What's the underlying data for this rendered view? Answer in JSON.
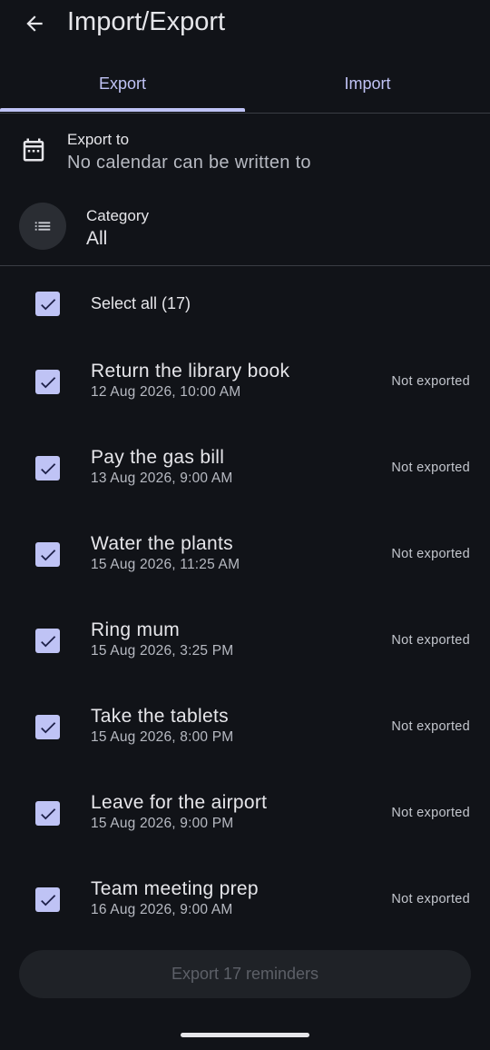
{
  "appbar": {
    "title": "Import/Export",
    "back_icon": "arrow-left-icon"
  },
  "tabs": [
    {
      "label": "Export",
      "selected": true
    },
    {
      "label": "Import",
      "selected": false
    }
  ],
  "export_to": {
    "label": "Export to",
    "value": "No calendar can be written to",
    "icon": "calendar-icon"
  },
  "category": {
    "label": "Category",
    "value": "All",
    "icon": "list-icon"
  },
  "select_all": {
    "label": "Select all (17)",
    "checked": true
  },
  "reminders": [
    {
      "title": "Return the library book",
      "date": "12 Aug 2026, 10:00 AM",
      "status": "Not exported",
      "checked": true
    },
    {
      "title": "Pay the gas bill",
      "date": "13 Aug 2026, 9:00 AM",
      "status": "Not exported",
      "checked": true
    },
    {
      "title": "Water the plants",
      "date": "15 Aug 2026, 11:25 AM",
      "status": "Not exported",
      "checked": true
    },
    {
      "title": "Ring mum",
      "date": "15 Aug 2026, 3:25 PM",
      "status": "Not exported",
      "checked": true
    },
    {
      "title": "Take the tablets",
      "date": "15 Aug 2026, 8:00 PM",
      "status": "Not exported",
      "checked": true
    },
    {
      "title": "Leave for the airport",
      "date": "15 Aug 2026, 9:00 PM",
      "status": "Not exported",
      "checked": true
    },
    {
      "title": "Team meeting prep",
      "date": "16 Aug 2026, 9:00 AM",
      "status": "Not exported",
      "checked": true
    }
  ],
  "export_button": {
    "label": "Export 17 reminders",
    "enabled": false
  },
  "colors": {
    "background": "#111318",
    "accent": "#bfc3f5",
    "text": "#e6e6ea",
    "secondary_text": "#b7bac2",
    "disabled_button": "#1f2227"
  }
}
